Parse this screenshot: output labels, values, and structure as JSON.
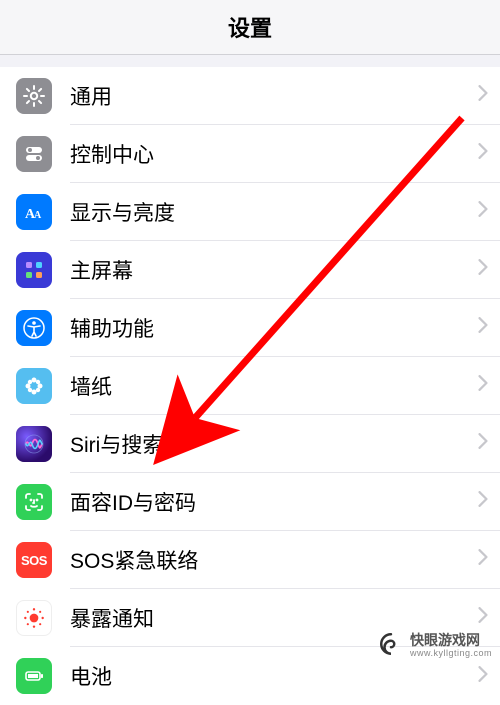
{
  "header": {
    "title": "设置"
  },
  "items": [
    {
      "key": "general",
      "label": "通用"
    },
    {
      "key": "control-center",
      "label": "控制中心"
    },
    {
      "key": "display",
      "label": "显示与亮度"
    },
    {
      "key": "home-screen",
      "label": "主屏幕"
    },
    {
      "key": "accessibility",
      "label": "辅助功能"
    },
    {
      "key": "wallpaper",
      "label": "墙纸"
    },
    {
      "key": "siri-search",
      "label": "Siri与搜索"
    },
    {
      "key": "faceid",
      "label": "面容ID与密码"
    },
    {
      "key": "sos",
      "label": "SOS紧急联络"
    },
    {
      "key": "exposure",
      "label": "暴露通知"
    },
    {
      "key": "battery",
      "label": "电池"
    }
  ],
  "sos_text": "SOS",
  "watermark": {
    "brand": "快眼游戏网",
    "url": "www.kyllgting.com"
  },
  "arrow": {
    "target_key": "siri-search"
  }
}
